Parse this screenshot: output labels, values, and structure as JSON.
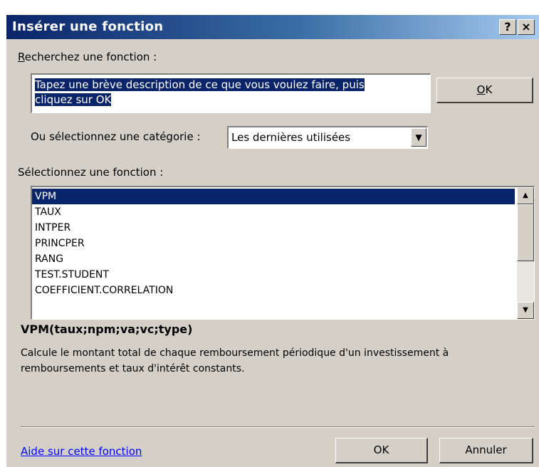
{
  "window": {
    "title": "Insérer une fonction",
    "help_button": "?",
    "close_button": "×"
  },
  "search": {
    "label_accel": "R",
    "label_rest": "echerchez une fonction :",
    "value_line1": "Tapez une brève description de ce que vous voulez faire, puis",
    "value_line2": "cliquez sur OK",
    "go_button_accel": "O",
    "go_button_rest": "K"
  },
  "category": {
    "label": "Ou sélectionnez une catégorie :",
    "selected": "Les dernières utilisées"
  },
  "functions": {
    "label": "Sélectionnez une fonction :",
    "items": [
      "VPM",
      "TAUX",
      "INTPER",
      "PRINCPER",
      "RANG",
      "TEST.STUDENT",
      "COEFFICIENT.CORRELATION"
    ],
    "selected_index": 0
  },
  "details": {
    "syntax": "VPM(taux;npm;va;vc;type)",
    "description": "Calcule le montant total de chaque remboursement périodique d'un investissement à remboursements et taux d'intérêt constants."
  },
  "footer": {
    "help_link": "Aide sur cette fonction",
    "ok_button": "OK",
    "cancel_button": "Annuler"
  },
  "colors": {
    "dialog_face": "#d4d0c8",
    "title_start": "#0a246a",
    "title_end": "#a6caf0",
    "selection": "#0a246a",
    "link": "#0000ff"
  }
}
